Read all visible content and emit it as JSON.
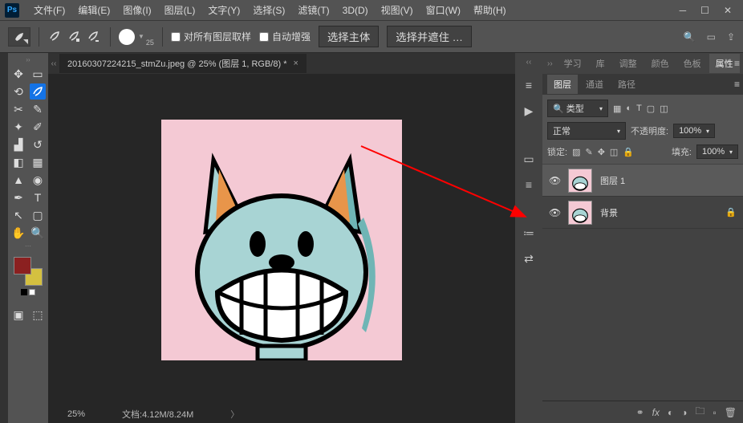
{
  "menubar": {
    "items": [
      "文件(F)",
      "编辑(E)",
      "图像(I)",
      "图层(L)",
      "文字(Y)",
      "选择(S)",
      "滤镜(T)",
      "3D(D)",
      "视图(V)",
      "窗口(W)",
      "帮助(H)"
    ]
  },
  "optionsbar": {
    "brush_size_label": "25",
    "sample_all": "对所有图层取样",
    "auto_enhance": "自动增强",
    "select_subject": "选择主体",
    "select_mask": "选择并遮住 …"
  },
  "document": {
    "tab_title": "20160307224215_stmZu.jpeg @ 25% (图层 1, RGB/8) *",
    "zoom": "25%",
    "filesize": "文档:4.12M/8.24M"
  },
  "panels": {
    "top_tabs": [
      "学习",
      "库",
      "调整",
      "颜色",
      "色板",
      "属性"
    ],
    "top_active": 5,
    "mid_tabs": [
      "图层",
      "通道",
      "路径"
    ],
    "mid_active": 0
  },
  "layer_panel": {
    "kind_label": "类型",
    "blend_mode": "正常",
    "opacity_label": "不透明度:",
    "opacity_value": "100%",
    "lock_label": "锁定:",
    "fill_label": "填充:",
    "fill_value": "100%",
    "layers": [
      {
        "name": "图层 1",
        "locked": false,
        "selected": true
      },
      {
        "name": "背景",
        "locked": true,
        "selected": false
      }
    ]
  },
  "colors": {
    "foreground": "#8b2020",
    "background_swatch": "#d4c040"
  }
}
